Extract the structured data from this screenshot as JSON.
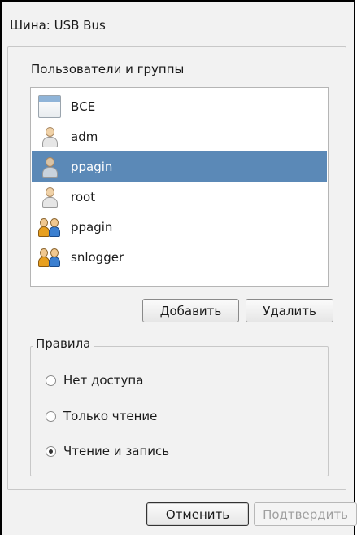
{
  "bus": {
    "label": "Шина:",
    "value": "USB Bus"
  },
  "users_section": {
    "title": "Пользователи и группы",
    "items": [
      {
        "label": "ВСЕ",
        "icon": "all-users-icon",
        "selected": false
      },
      {
        "label": "adm",
        "icon": "user-icon",
        "selected": false
      },
      {
        "label": "ppagin",
        "icon": "user-icon",
        "selected": true
      },
      {
        "label": "root",
        "icon": "user-icon",
        "selected": false
      },
      {
        "label": "ppagin",
        "icon": "group-icon",
        "selected": false
      },
      {
        "label": "snlogger",
        "icon": "group-icon",
        "selected": false
      }
    ],
    "add_label": "Добавить",
    "remove_label": "Удалить"
  },
  "rules": {
    "title": "Правила",
    "options": [
      {
        "label": "Нет доступа",
        "checked": false
      },
      {
        "label": "Только чтение",
        "checked": false
      },
      {
        "label": "Чтение и запись",
        "checked": true
      }
    ]
  },
  "footer": {
    "cancel_label": "Отменить",
    "confirm_label": "Подтвердить"
  },
  "colors": {
    "selection": "#5b89b7",
    "background": "#f2f2f2"
  }
}
